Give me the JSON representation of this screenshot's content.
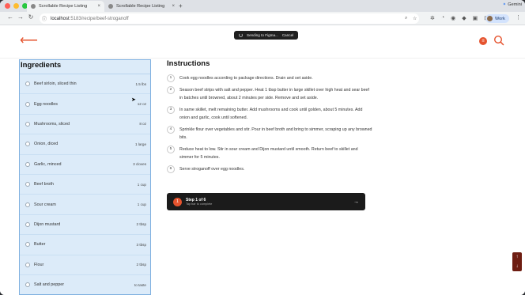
{
  "browser": {
    "tabs": [
      {
        "title": "Scrollable Recipe Listing",
        "active": true
      },
      {
        "title": "Scrollable Recipe Listing",
        "active": false
      }
    ],
    "new_tab": "+",
    "gemini_label": "Gemini",
    "url_host": "localhost",
    "url_path": ":5183/recipe/beef-stroganoff",
    "profile_label": "Work"
  },
  "figma_toast": {
    "text": "Sending to Figma...",
    "cancel": "Cancel"
  },
  "ingredients": {
    "title": "Ingredients",
    "items": [
      {
        "name": "Beef sirloin, sliced thin",
        "amount": "1.5 lbs"
      },
      {
        "name": "Egg noodles",
        "amount": "12 oz"
      },
      {
        "name": "Mushrooms, sliced",
        "amount": "8 oz"
      },
      {
        "name": "Onion, diced",
        "amount": "1 large"
      },
      {
        "name": "Garlic, minced",
        "amount": "3 cloves"
      },
      {
        "name": "Beef broth",
        "amount": "1 cup"
      },
      {
        "name": "Sour cream",
        "amount": "1 cup"
      },
      {
        "name": "Dijon mustard",
        "amount": "2 tbsp"
      },
      {
        "name": "Butter",
        "amount": "3 tbsp"
      },
      {
        "name": "Flour",
        "amount": "2 tbsp"
      },
      {
        "name": "Salt and pepper",
        "amount": "to taste"
      }
    ]
  },
  "instructions": {
    "title": "Instructions",
    "steps": [
      {
        "n": "1",
        "text": "Cook egg noodles according to package directions. Drain and set aside."
      },
      {
        "n": "2",
        "text": "Season beef strips with salt and pepper. Heat 1 tbsp butter in large skillet over high heat and sear beef in batches until browned, about 2 minutes per side. Remove and set aside."
      },
      {
        "n": "3",
        "text": "In same skillet, melt remaining butter. Add mushrooms and cook until golden, about 5 minutes. Add onion and garlic, cook until softened."
      },
      {
        "n": "4",
        "text": "Sprinkle flour over vegetables and stir. Pour in beef broth and bring to simmer, scraping up any browned bits."
      },
      {
        "n": "5",
        "text": "Reduce heat to low. Stir in sour cream and Dijon mustard until smooth. Return beef to skillet and simmer for 5 minutes."
      },
      {
        "n": "6",
        "text": "Serve stroganoff over egg noodles."
      }
    ]
  },
  "progress": {
    "badge": "1",
    "title": "Step 1 of 6",
    "subtitle": "Tap bar to complete"
  },
  "colors": {
    "accent": "#e5532e",
    "panel": "#dcebf9"
  }
}
